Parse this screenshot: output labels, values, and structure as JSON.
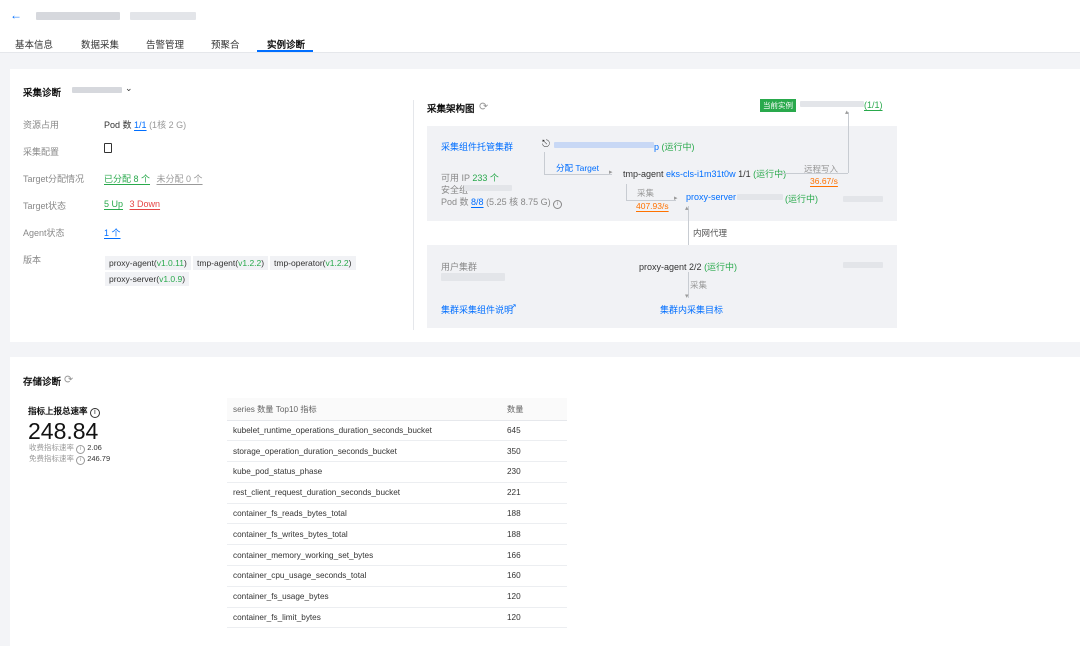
{
  "header": {
    "back_icon": "arrow-left-icon"
  },
  "tabs": [
    {
      "label": "基本信息"
    },
    {
      "label": "数据采集"
    },
    {
      "label": "告警管理"
    },
    {
      "label": "预聚合"
    },
    {
      "label": "实例诊断"
    }
  ],
  "collect": {
    "title": "采集诊断",
    "rows": {
      "resource_label": "资源占用",
      "resource_value": "Pod 数",
      "resource_count": "1/1",
      "resource_detail": "(1核 2 G)",
      "config_label": "采集配置",
      "target_label": "Target分配情况",
      "target_assigned": "已分配 8 个",
      "target_unassigned": "未分配 0 个",
      "status_label": "Target状态",
      "status_up": "5 Up",
      "status_down": "3 Down",
      "agent_label": "Agent状态",
      "agent_value": "1 个",
      "version_label": "版本"
    },
    "versions": [
      {
        "name": "proxy-agent(",
        "ver": "v1.0.11",
        "end": ")"
      },
      {
        "name": "tmp-agent(",
        "ver": "v1.2.2",
        "end": ")"
      },
      {
        "name": "tmp-operator(",
        "ver": "v1.2.2",
        "end": ")"
      },
      {
        "name": "proxy-server(",
        "ver": "v1.0.9",
        "end": ")"
      }
    ]
  },
  "arch": {
    "title": "采集架构图",
    "current_badge": "当前实例",
    "current_count": "(1/1)",
    "hosted_cluster": "采集组件托管集群",
    "running1": "(运行中)",
    "assign_target": "分配 Target",
    "tmp_agent": "tmp-agent",
    "tmp_agent_id": "eks-cls-i1m31t0w",
    "tmp_agent_count": "1/1",
    "running2": "(运行中)",
    "remote_write": "远程写入",
    "remote_rate": "36.67/s",
    "available_ip": "可用 IP",
    "ip_count": "233 个",
    "sec_group": "安全组",
    "pod_count_label": "Pod 数",
    "pod_count": "8/8",
    "pod_detail": "(5.25 核 8.75 G)",
    "collect1": "采集",
    "collect_rate": "407.93/s",
    "proxy_server": "proxy-server",
    "running3": "(运行中)",
    "intranet_proxy": "内网代理",
    "user_cluster": "用户集群",
    "proxy_agent": "proxy-agent 2/2",
    "running4": "(运行中)",
    "collect2": "采集",
    "cluster_doc": "集群采集组件说明",
    "cluster_target": "集群内采集目标"
  },
  "storage": {
    "title": "存储诊断",
    "metric_title": "指标上报总速率",
    "total": "248.84",
    "paid_label": "收费指标速率",
    "paid_value": "2.06",
    "free_label": "免费指标速率",
    "free_value": "246.79",
    "table_header": [
      "series 数量 Top10 指标",
      "数量"
    ],
    "rows": [
      [
        "kubelet_runtime_operations_duration_seconds_bucket",
        "645"
      ],
      [
        "storage_operation_duration_seconds_bucket",
        "350"
      ],
      [
        "kube_pod_status_phase",
        "230"
      ],
      [
        "rest_client_request_duration_seconds_bucket",
        "221"
      ],
      [
        "container_fs_reads_bytes_total",
        "188"
      ],
      [
        "container_fs_writes_bytes_total",
        "188"
      ],
      [
        "container_memory_working_set_bytes",
        "166"
      ],
      [
        "container_cpu_usage_seconds_total",
        "160"
      ],
      [
        "container_fs_usage_bytes",
        "120"
      ],
      [
        "container_fs_limit_bytes",
        "120"
      ]
    ]
  }
}
